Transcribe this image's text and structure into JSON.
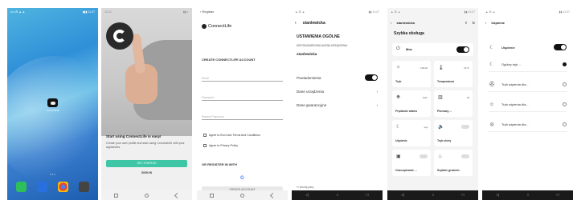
{
  "p1": {
    "status_left": "•••• ⁂ ▲ ▲",
    "status_right": "▮▮▮ 11:27",
    "app_label": "ConnectLife",
    "dots": "• • •",
    "dock_colors": [
      "#2fbf5a",
      "#2a6fe0",
      "#f2f2f2",
      "#444444"
    ]
  },
  "p2": {
    "status_left": "12:12",
    "status_right": "▮▮ ◐",
    "title": "Start using ConnectLife is easy!",
    "subtitle": "Create your user profile and start using ConnectLife with your appliances.",
    "primary_button": "GET STARTED",
    "secondary_button": "SIGN IN"
  },
  "p3": {
    "header": "Register",
    "brand": "ConnectLife",
    "heading": "CREATE CONNECTLIFE ACCOUNT",
    "email_placeholder": "Email",
    "password_placeholder": "Password",
    "repeat_password_placeholder": "Repeat Password",
    "terms_label": "Agree to End User Terms And Conditions",
    "privacy_label": "Agree to Privacy Policy",
    "or_register": "OR REGISTER IN WITH",
    "google_glyph": "G",
    "create_button": "CREATE ACCOUNT"
  },
  "p4": {
    "title": "stanlewicka",
    "section": "USTAWIENIA OGÓLNE",
    "custom_name_label": "NIESTANDARDOWA NAZWA URZĄDZENIA",
    "custom_name_value": "stanlewicka",
    "notifications": "Powiadomienia",
    "device_data": "Dane urządzenia",
    "warranty_data": "Dane gwarancyjne",
    "bottom_text": "Anuluj parę"
  },
  "p5": {
    "title": "stanlewicka",
    "section": "Szybka obsługa",
    "power_label": "Moc",
    "cards": [
      {
        "icon": "☼",
        "label": "Tryb",
        "value": "Chłodz"
      },
      {
        "icon": "🌡",
        "label": "Temperatura",
        "value": "21°C"
      },
      {
        "icon": "❋",
        "label": "Prędkość wiatru",
        "value": "Auto"
      },
      {
        "icon": "▥",
        "label": "Pionowy ...",
        "value": "off"
      },
      {
        "icon": "☾",
        "label": "Uśpienie",
        "value": "wył"
      },
      {
        "icon": "🔈",
        "label": "Tryb cichy",
        "value": ""
      },
      {
        "icon": "▣",
        "label": "Oszczędzanie ...",
        "value": ""
      },
      {
        "icon": "♨",
        "label": "Szybkie grzanie/...",
        "value": ""
      }
    ]
  },
  "p6": {
    "title": "Uśpienie",
    "header_label": "Uśpienie",
    "options": [
      {
        "icon": "☾",
        "label": "Ogólny tryb ..."
      },
      {
        "icon": "⛑",
        "label": "Tryb uśpienia dla..."
      },
      {
        "icon": "☺",
        "label": "Tryb uśpienia dla..."
      },
      {
        "icon": "◎",
        "label": "Tryb uśpienia dla..."
      }
    ]
  }
}
